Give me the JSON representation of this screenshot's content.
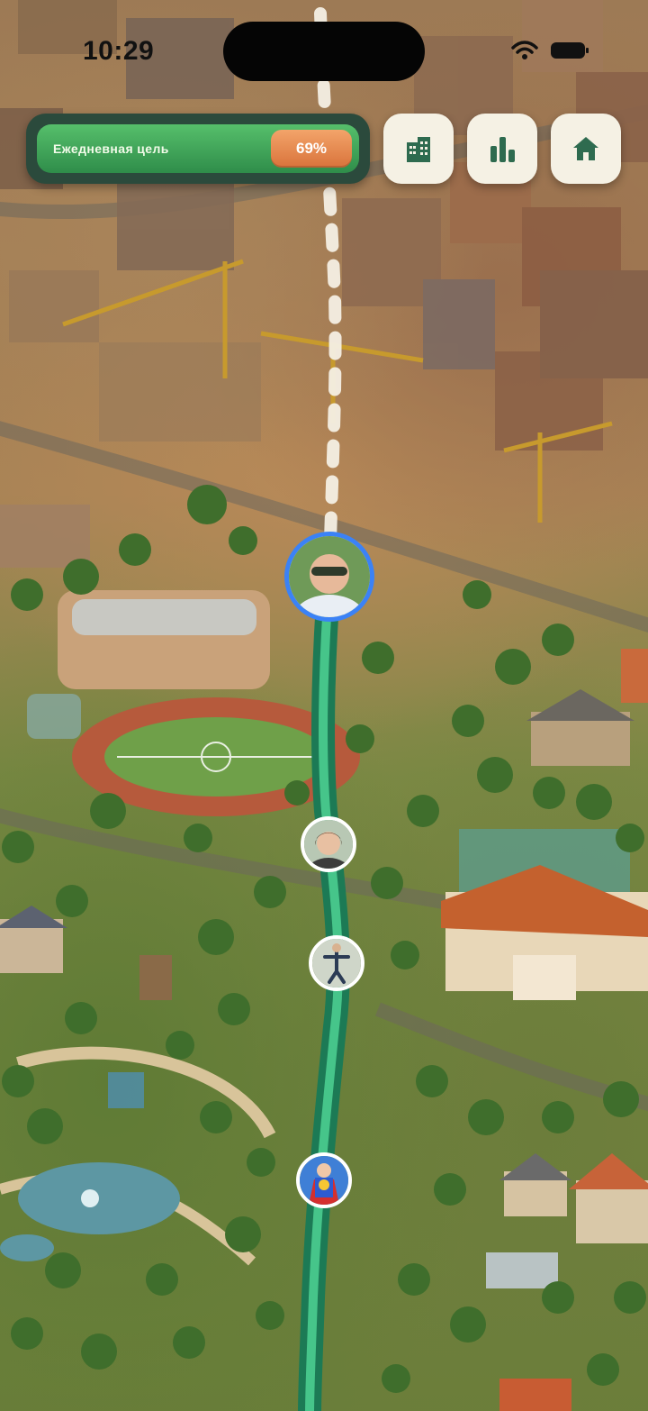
{
  "status_bar": {
    "time": "10:29"
  },
  "daily_goal": {
    "label": "Ежедневная цель",
    "percent_text": "69%",
    "progress": 0.69
  },
  "toolbar": {
    "buttons": [
      {
        "icon": "city-icon"
      },
      {
        "icon": "bar-chart-icon"
      },
      {
        "icon": "home-icon"
      }
    ]
  },
  "map": {
    "route": {
      "completed_color": "#2f9b6a",
      "remaining_color": "#f4efe4"
    },
    "avatars": [
      {
        "name": "current-user-avatar",
        "ring": "#3b82f6"
      },
      {
        "name": "friend-avatar-1",
        "ring": "#ffffff"
      },
      {
        "name": "friend-avatar-2",
        "ring": "#ffffff"
      },
      {
        "name": "friend-avatar-3",
        "ring": "#ffffff"
      }
    ]
  },
  "colors": {
    "accent": "#3a9e57",
    "badge": "#e68847",
    "panel": "#2b4a3c",
    "button_bg": "#f5f1e4",
    "icon": "#2e6b4f"
  }
}
